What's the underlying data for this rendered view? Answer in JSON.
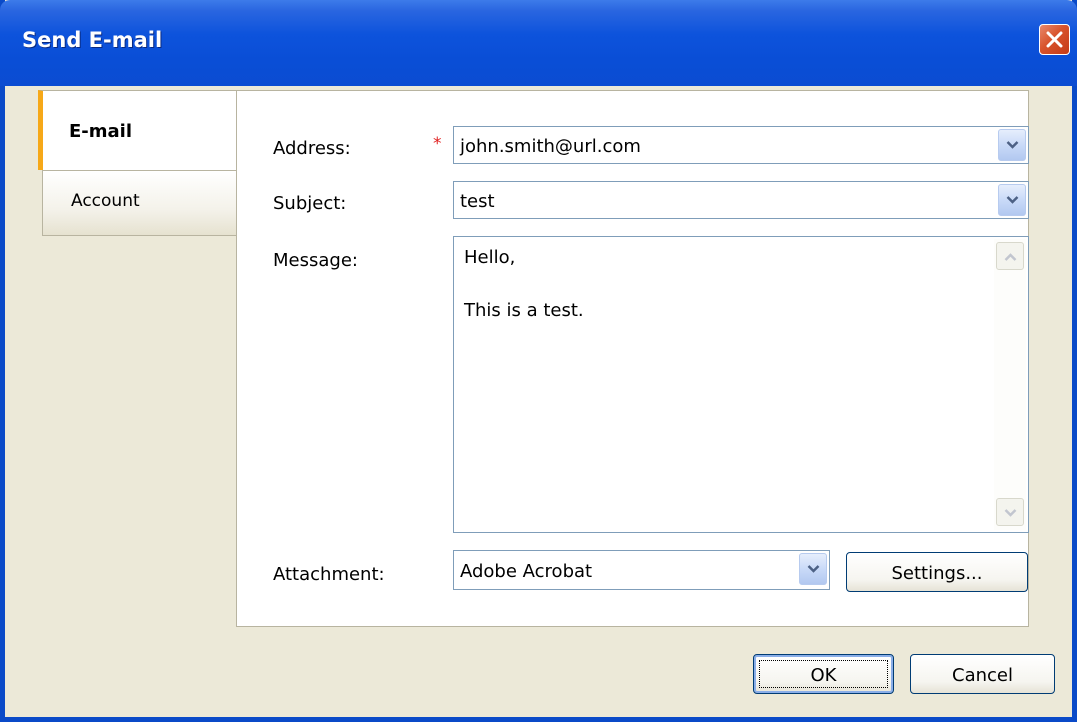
{
  "window": {
    "title": "Send E-mail"
  },
  "tabs": [
    {
      "label": "E-mail",
      "active": true
    },
    {
      "label": "Account",
      "active": false
    }
  ],
  "form": {
    "address": {
      "label": "Address:",
      "required_marker": "*",
      "value": "john.smith@url.com"
    },
    "subject": {
      "label": "Subject:",
      "value": "test"
    },
    "message": {
      "label": "Message:",
      "lines": [
        "Hello,",
        "This is a test."
      ]
    },
    "attachment": {
      "label": "Attachment:",
      "value": "Adobe Acrobat",
      "settings_label": "Settings..."
    }
  },
  "buttons": {
    "ok_label": "OK",
    "cancel_label": "Cancel"
  },
  "colors": {
    "titlebar": "#0a4ed6",
    "active_tab_accent": "#f6a818",
    "required_marker": "#e02020",
    "close_button": "#d8532c",
    "dialog_background": "#ece9d8"
  },
  "icons": [
    "close-icon",
    "chevron-down-icon",
    "scroll-up-arrow-icon",
    "scroll-down-arrow-icon"
  ]
}
